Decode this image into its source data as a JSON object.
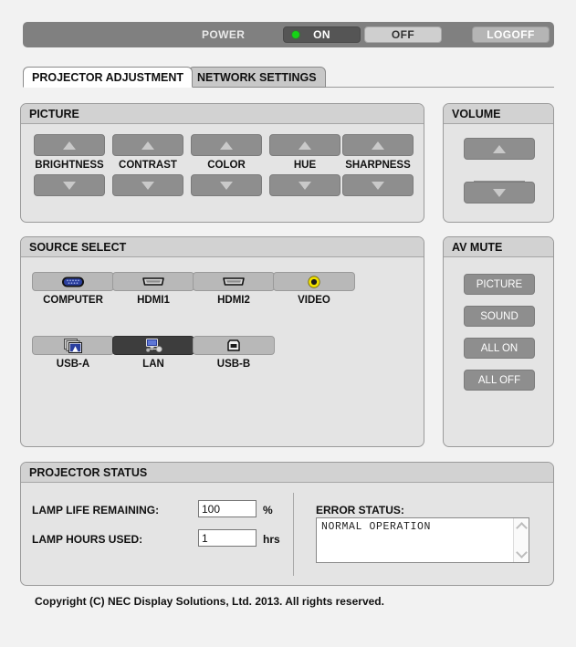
{
  "power": {
    "label": "POWER",
    "on_label": "ON",
    "off_label": "OFF",
    "logoff_label": "LOGOFF",
    "state": "ON",
    "led_color": "#16d316"
  },
  "tabs": [
    {
      "label": "PROJECTOR ADJUSTMENT",
      "active": true
    },
    {
      "label": "NETWORK SETTINGS",
      "active": false
    }
  ],
  "picture": {
    "title": "PICTURE",
    "controls": [
      {
        "label": "BRIGHTNESS",
        "up": "▲",
        "down": "▼"
      },
      {
        "label": "CONTRAST",
        "up": "▲",
        "down": "▼"
      },
      {
        "label": "COLOR",
        "up": "▲",
        "down": "▼"
      },
      {
        "label": "HUE",
        "up": "▲",
        "down": "▼"
      },
      {
        "label": "SHARPNESS",
        "up": "▲",
        "down": "▼"
      }
    ]
  },
  "volume": {
    "title": "VOLUME",
    "up_icon": "triangle-up-icon",
    "down_icon": "triangle-down-icon"
  },
  "source_select": {
    "title": "SOURCE SELECT",
    "sources": [
      {
        "label": "COMPUTER",
        "icon": "vga-connector-icon",
        "selected": false
      },
      {
        "label": "HDMI1",
        "icon": "hdmi-connector-icon",
        "selected": false
      },
      {
        "label": "HDMI2",
        "icon": "hdmi-connector-icon",
        "selected": false
      },
      {
        "label": "VIDEO",
        "icon": "rca-connector-icon",
        "selected": false
      },
      {
        "label": "USB-A",
        "icon": "usb-a-photos-icon",
        "selected": false
      },
      {
        "label": "LAN",
        "icon": "lan-network-icon",
        "selected": true
      },
      {
        "label": "USB-B",
        "icon": "usb-b-port-icon",
        "selected": false
      }
    ]
  },
  "av_mute": {
    "title": "AV MUTE",
    "buttons": [
      {
        "label": "PICTURE"
      },
      {
        "label": "SOUND"
      },
      {
        "label": "ALL ON"
      },
      {
        "label": "ALL OFF"
      }
    ]
  },
  "projector_status": {
    "title": "PROJECTOR STATUS",
    "lamp_life_label": "LAMP LIFE REMAINING:",
    "lamp_life_value": "100",
    "lamp_life_unit": "%",
    "lamp_hours_label": "LAMP HOURS USED:",
    "lamp_hours_value": "1",
    "lamp_hours_unit": "hrs",
    "error_status_label": "ERROR STATUS:",
    "error_status_text": "NORMAL OPERATION"
  },
  "footer": {
    "copyright": "Copyright (C) NEC Display Solutions, Ltd. 2013. All rights reserved."
  },
  "colors": {
    "page_bg": "#f2f2f2",
    "panel_bg": "#e4e4e4",
    "panel_header_bg": "#d2d2d2",
    "button_gray": "#8e8e8e",
    "powerbar_gray": "#808080",
    "selected_dark": "#3d3d3d",
    "led_green": "#16d316",
    "vga_blue": "#2b3f9e",
    "rca_yellow": "#f2e200"
  }
}
